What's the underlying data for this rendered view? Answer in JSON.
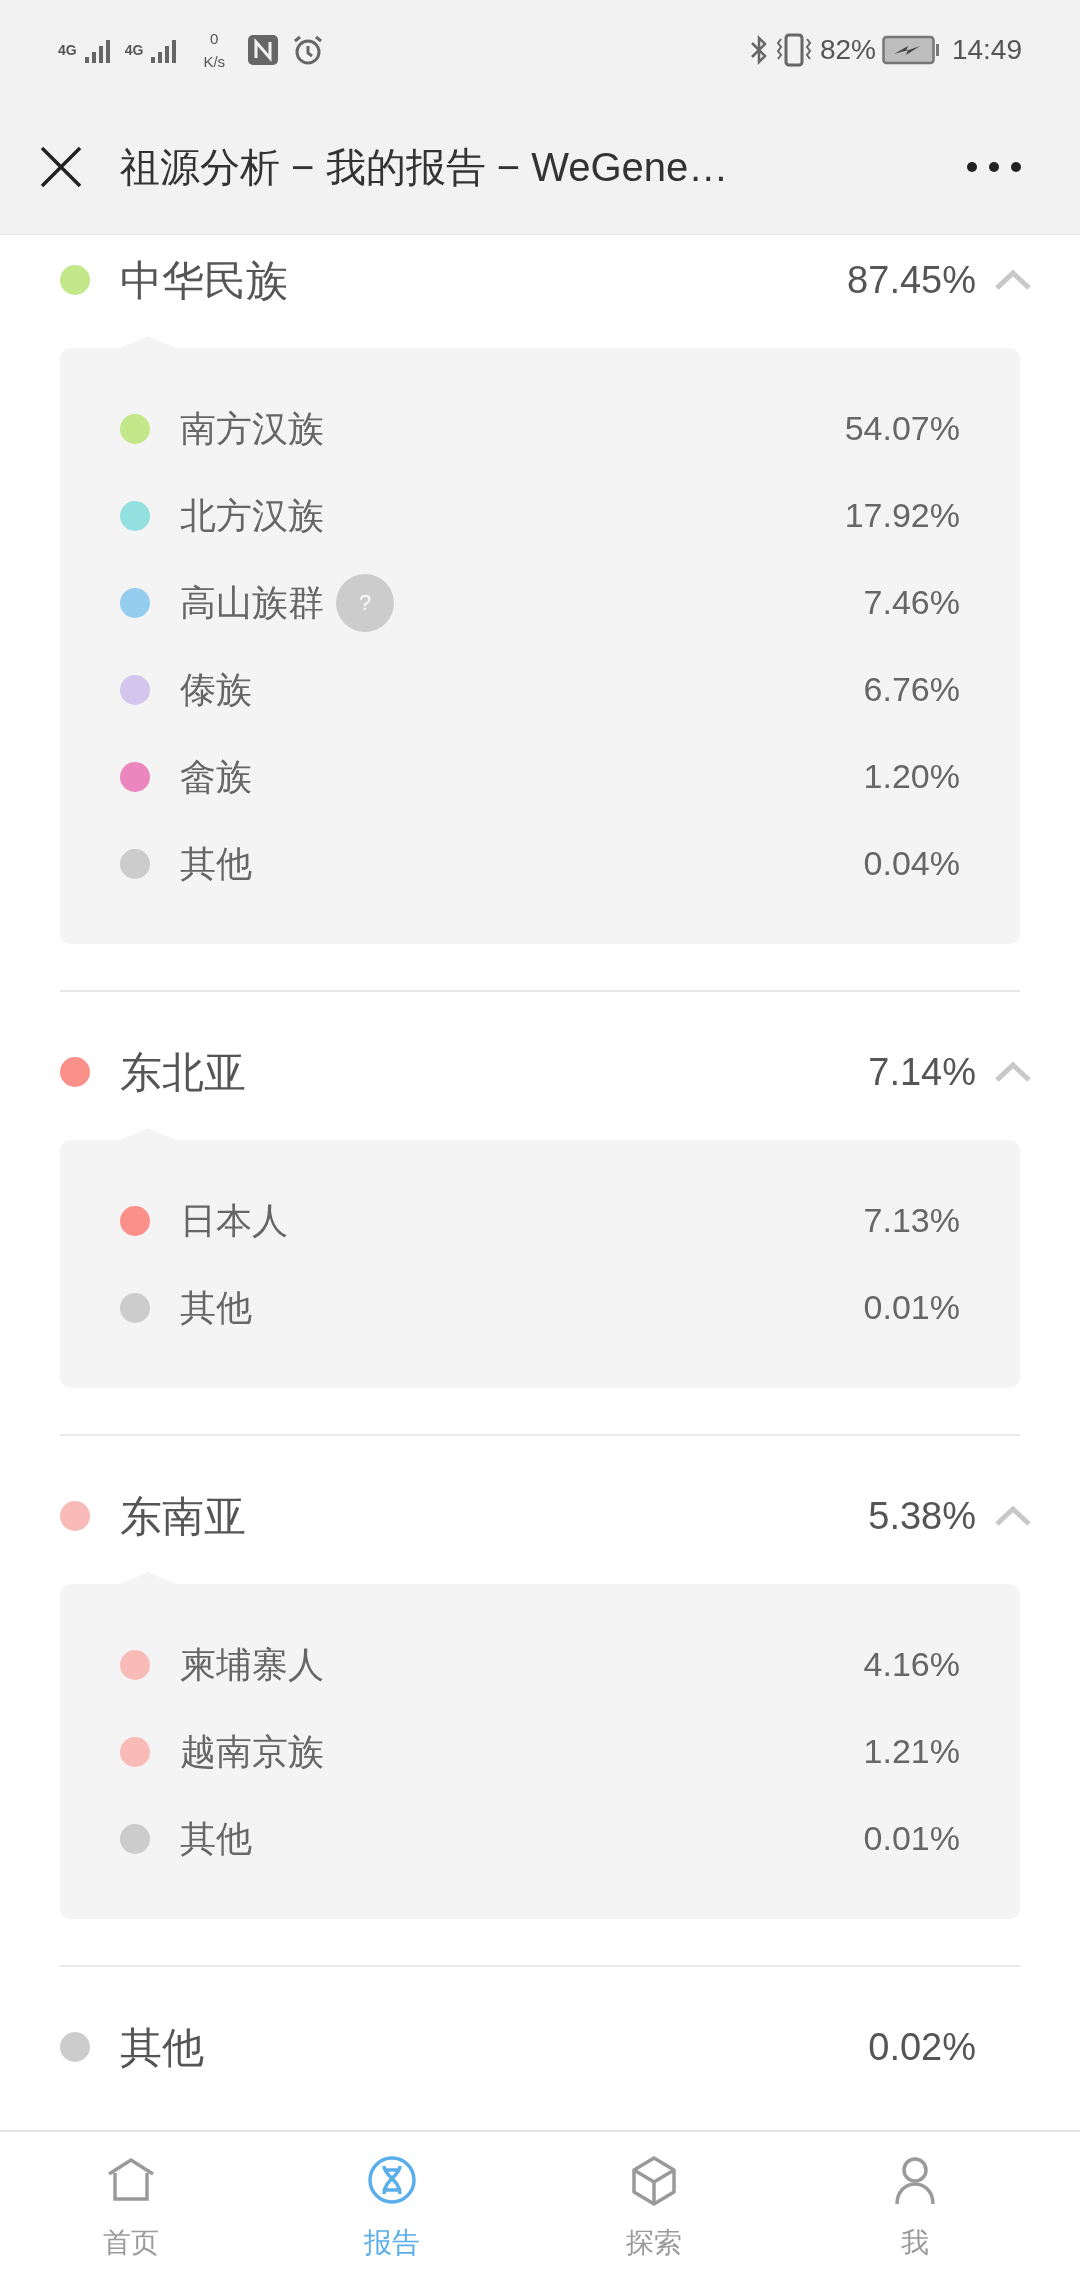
{
  "status_bar": {
    "network_1": "4G",
    "network_2": "4G",
    "speed_value": "0",
    "speed_unit": "K/s",
    "battery": "82%",
    "time": "14:49"
  },
  "title_bar": {
    "title": "祖源分析 − 我的报告 − WeGene…"
  },
  "groups": [
    {
      "kind": "group",
      "name": "中华民族",
      "percent": "87.45%",
      "color": "#c3e88a",
      "expanded": true,
      "children": [
        {
          "name": "南方汉族",
          "percent": "54.07%",
          "color": "#c3e88a",
          "help": false
        },
        {
          "name": "北方汉族",
          "percent": "17.92%",
          "color": "#93e0e0",
          "help": false
        },
        {
          "name": "高山族群",
          "percent": "7.46%",
          "color": "#94cdf0",
          "help": true,
          "help_label": "?"
        },
        {
          "name": "傣族",
          "percent": "6.76%",
          "color": "#d3c5ec",
          "help": false
        },
        {
          "name": "畲族",
          "percent": "1.20%",
          "color": "#ec86bf",
          "help": false
        },
        {
          "name": "其他",
          "percent": "0.04%",
          "color": "#cccccc",
          "help": false
        }
      ]
    },
    {
      "kind": "group",
      "name": "东北亚",
      "percent": "7.14%",
      "color": "#fb8f8a",
      "expanded": true,
      "children": [
        {
          "name": "日本人",
          "percent": "7.13%",
          "color": "#fb8f8a",
          "help": false
        },
        {
          "name": "其他",
          "percent": "0.01%",
          "color": "#cccccc",
          "help": false
        }
      ]
    },
    {
      "kind": "group",
      "name": "东南亚",
      "percent": "5.38%",
      "color": "#f9bbb8",
      "expanded": true,
      "children": [
        {
          "name": "柬埔寨人",
          "percent": "4.16%",
          "color": "#f9bbb8",
          "help": false
        },
        {
          "name": "越南京族",
          "percent": "1.21%",
          "color": "#f9bbb8",
          "help": false
        },
        {
          "name": "其他",
          "percent": "0.01%",
          "color": "#cccccc",
          "help": false
        }
      ]
    },
    {
      "kind": "single",
      "name": "其他",
      "percent": "0.02%",
      "color": "#cccccc"
    }
  ],
  "tab_bar": [
    {
      "label": "首页",
      "selected": false
    },
    {
      "label": "报告",
      "selected": true
    },
    {
      "label": "探索",
      "selected": false
    },
    {
      "label": "我",
      "selected": false
    }
  ]
}
